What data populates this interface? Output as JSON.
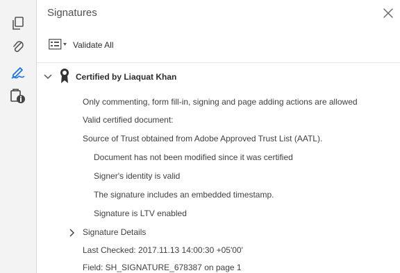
{
  "rail": {
    "items": [
      {
        "icon": "pages-icon"
      },
      {
        "icon": "attachment-icon"
      },
      {
        "icon": "signature-icon",
        "active": true
      },
      {
        "icon": "security-lock-icon"
      }
    ]
  },
  "panel": {
    "title": "Signatures",
    "toolbar": {
      "validate_all_label": "Validate All"
    },
    "signature": {
      "name": "Certified by Liaquat Khan",
      "details": {
        "permissions": "Only commenting, form fill-in, signing and page adding actions are allowed",
        "valid_cert": "Valid certified document:",
        "trust_source": "Source of Trust obtained from Adobe Approved Trust List (AATL).",
        "not_modified": "Document has not been modified since it was certified",
        "identity_valid": "Signer's identity is valid",
        "timestamp": "The signature includes an embedded timestamp.",
        "ltv": "Signature is LTV enabled",
        "signature_details_label": "Signature Details",
        "last_checked": "Last Checked: 2017.11.13 14:00:30 +05'00'",
        "field": "Field: SH_SIGNATURE_678387 on page 1"
      }
    }
  },
  "colors": {
    "accent": "#1473e6",
    "rail_bg": "#f3f3f3",
    "text": "#3f3f3f"
  }
}
